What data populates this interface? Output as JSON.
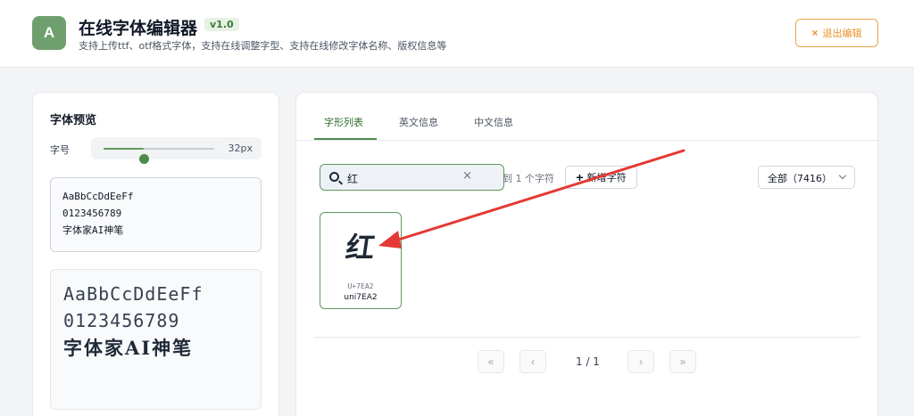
{
  "header": {
    "logo_letter": "A",
    "title": "在线字体编辑器",
    "version": "v1.0",
    "subtitle": "支持上传ttf、otf格式字体，支持在线调整字型、支持在线修改字体名称、版权信息等",
    "exit_label": "退出编辑",
    "exit_icon": "×"
  },
  "preview": {
    "title": "字体预览",
    "size_label": "字号",
    "size_value": "32px",
    "slider_fraction": 0.36,
    "sample_text": "AaBbCcDdEeFf\n0123456789\n字体家AI神笔",
    "render_lines": [
      "AaBbCcDdEeFf",
      "0123456789",
      "字体家AI神笔"
    ]
  },
  "tabs": [
    {
      "label": "字形列表",
      "active": true
    },
    {
      "label": "英文信息",
      "active": false
    },
    {
      "label": "中文信息",
      "active": false
    }
  ],
  "search": {
    "value": "红",
    "clear_icon": "×",
    "result_count": "到 1 个字符"
  },
  "toolbar": {
    "add_label": "新增字符",
    "add_icon": "+",
    "filter_value": "全部（7416）"
  },
  "glyphs": [
    {
      "char": "红",
      "unicode": "U+7EA2",
      "name": "uni7EA2"
    }
  ],
  "pagination": {
    "first_icon": "«",
    "prev_icon": "‹",
    "page_text": "1 / 1",
    "next_icon": "›",
    "last_icon": "»"
  },
  "colors": {
    "accent": "#4d8b4a",
    "logo_bg": "#6f9f6e",
    "exit": "#e8942a",
    "annotation": "#e53935"
  }
}
